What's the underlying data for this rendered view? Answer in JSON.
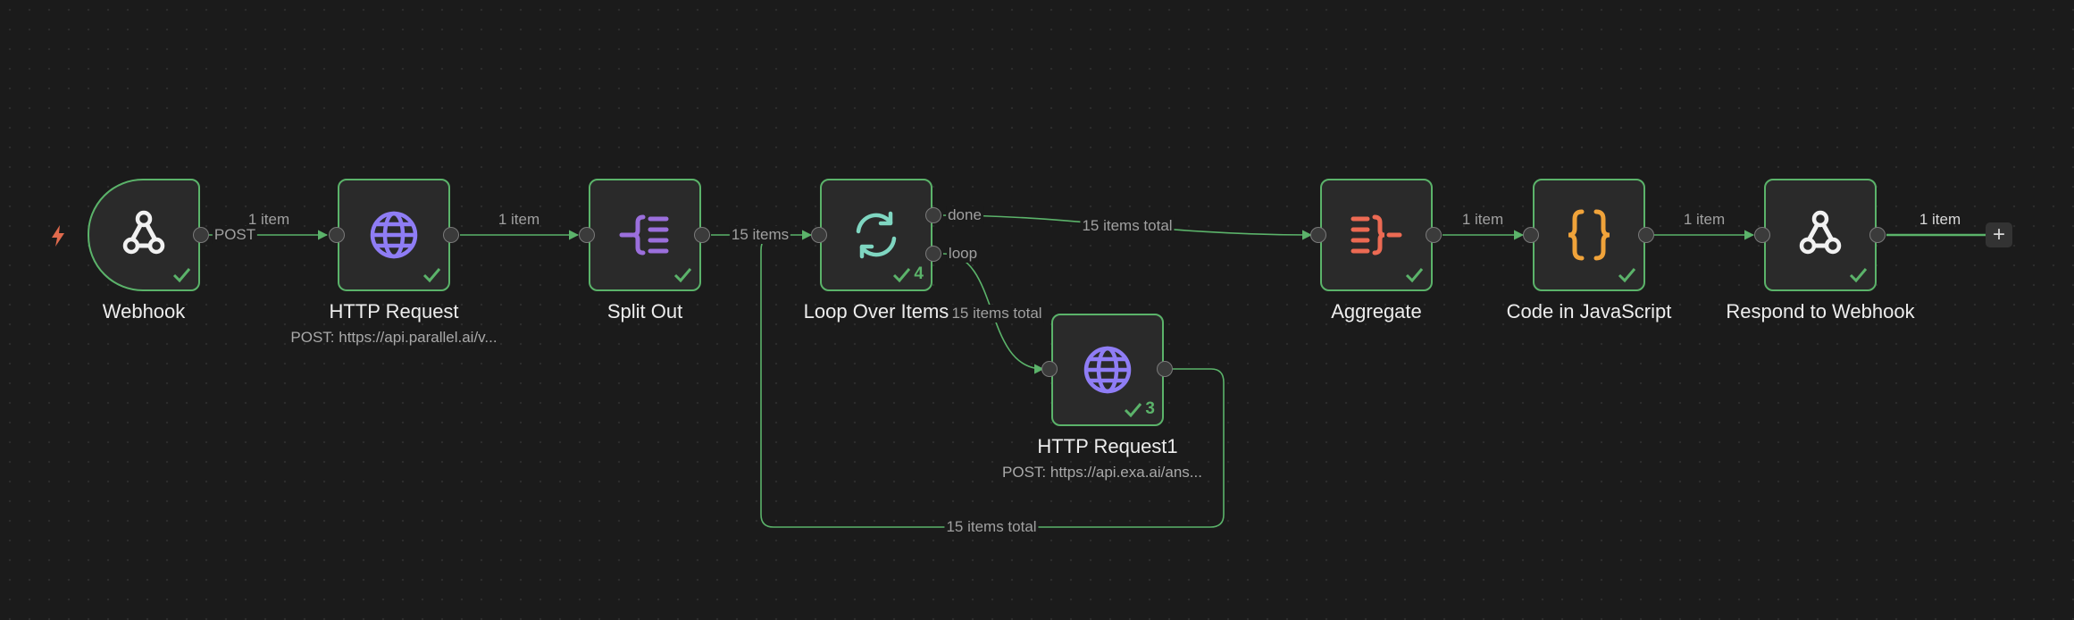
{
  "colors": {
    "canvas": "#1b1b1b",
    "node_bg": "#2a2a2a",
    "success": "#5bb36a",
    "trigger_bolt": "#e06a4d"
  },
  "trigger": {
    "icon": "lightning-bolt-icon"
  },
  "nodes": {
    "webhook": {
      "title": "Webhook",
      "icon": "webhook-icon"
    },
    "http_request": {
      "title": "HTTP Request",
      "subtitle": "POST: https://api.parallel.ai/v...",
      "icon": "globe-icon"
    },
    "split_out": {
      "title": "Split Out",
      "icon": "split-out-icon"
    },
    "loop_over_items": {
      "title": "Loop Over Items",
      "icon": "loop-icon",
      "run_count": "4"
    },
    "http_request1": {
      "title": "HTTP Request1",
      "subtitle": "POST: https://api.exa.ai/ans...",
      "icon": "globe-icon",
      "run_count": "3"
    },
    "aggregate": {
      "title": "Aggregate",
      "icon": "aggregate-icon"
    },
    "code_js": {
      "title": "Code in JavaScript",
      "icon": "code-braces-icon"
    },
    "respond_webhook": {
      "title": "Respond to Webhook",
      "icon": "webhook-icon"
    }
  },
  "edges": {
    "webhook_http": {
      "method": "POST",
      "count": "1 item"
    },
    "http_split": "1 item",
    "split_loop": "15 items",
    "loop_done": {
      "branch": "done",
      "count": "15 items total"
    },
    "loop_loop": {
      "branch": "loop",
      "count": "15 items total"
    },
    "http1_back": "15 items total",
    "agg_code": "1 item",
    "code_respond": "1 item",
    "respond_out": "1 item"
  },
  "add_button": "+"
}
